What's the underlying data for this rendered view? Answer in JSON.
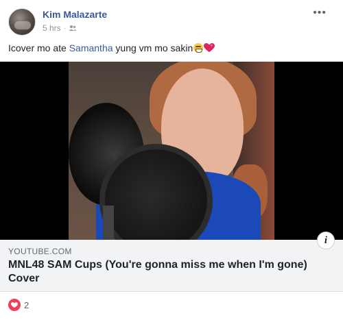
{
  "post": {
    "author": "Kim Malazarte",
    "time": "5 hrs",
    "separator": "·",
    "audience_icon": "friends-icon",
    "more_icon": "more-icon",
    "more_glyph": "•••",
    "caption": {
      "text_before": "Icover mo ate ",
      "mention": "Samantha",
      "text_after": " yung vm mo sakin"
    }
  },
  "link_preview": {
    "domain": "YOUTUBE.COM",
    "title": "MNL48 SAM Cups (You're gonna miss me when I'm gone) Cover",
    "info_glyph": "i"
  },
  "reactions": {
    "type": "love",
    "count": "2"
  },
  "colors": {
    "link_blue": "#385898",
    "love_red": "#f33e58",
    "preview_bg": "#f2f3f5"
  }
}
